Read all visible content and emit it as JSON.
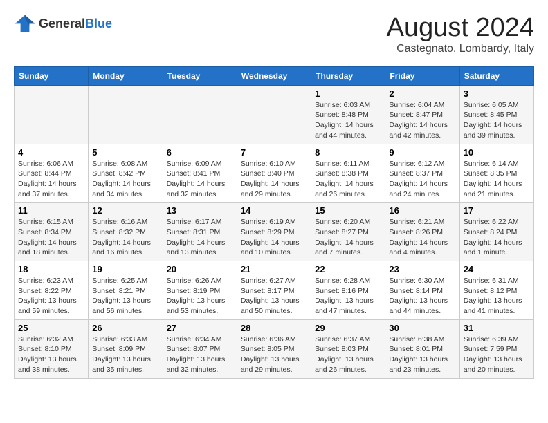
{
  "logo": {
    "text_general": "General",
    "text_blue": "Blue"
  },
  "header": {
    "month_year": "August 2024",
    "location": "Castegnato, Lombardy, Italy"
  },
  "days_of_week": [
    "Sunday",
    "Monday",
    "Tuesday",
    "Wednesday",
    "Thursday",
    "Friday",
    "Saturday"
  ],
  "weeks": [
    [
      {
        "day": "",
        "info": ""
      },
      {
        "day": "",
        "info": ""
      },
      {
        "day": "",
        "info": ""
      },
      {
        "day": "",
        "info": ""
      },
      {
        "day": "1",
        "info": "Sunrise: 6:03 AM\nSunset: 8:48 PM\nDaylight: 14 hours and 44 minutes."
      },
      {
        "day": "2",
        "info": "Sunrise: 6:04 AM\nSunset: 8:47 PM\nDaylight: 14 hours and 42 minutes."
      },
      {
        "day": "3",
        "info": "Sunrise: 6:05 AM\nSunset: 8:45 PM\nDaylight: 14 hours and 39 minutes."
      }
    ],
    [
      {
        "day": "4",
        "info": "Sunrise: 6:06 AM\nSunset: 8:44 PM\nDaylight: 14 hours and 37 minutes."
      },
      {
        "day": "5",
        "info": "Sunrise: 6:08 AM\nSunset: 8:42 PM\nDaylight: 14 hours and 34 minutes."
      },
      {
        "day": "6",
        "info": "Sunrise: 6:09 AM\nSunset: 8:41 PM\nDaylight: 14 hours and 32 minutes."
      },
      {
        "day": "7",
        "info": "Sunrise: 6:10 AM\nSunset: 8:40 PM\nDaylight: 14 hours and 29 minutes."
      },
      {
        "day": "8",
        "info": "Sunrise: 6:11 AM\nSunset: 8:38 PM\nDaylight: 14 hours and 26 minutes."
      },
      {
        "day": "9",
        "info": "Sunrise: 6:12 AM\nSunset: 8:37 PM\nDaylight: 14 hours and 24 minutes."
      },
      {
        "day": "10",
        "info": "Sunrise: 6:14 AM\nSunset: 8:35 PM\nDaylight: 14 hours and 21 minutes."
      }
    ],
    [
      {
        "day": "11",
        "info": "Sunrise: 6:15 AM\nSunset: 8:34 PM\nDaylight: 14 hours and 18 minutes."
      },
      {
        "day": "12",
        "info": "Sunrise: 6:16 AM\nSunset: 8:32 PM\nDaylight: 14 hours and 16 minutes."
      },
      {
        "day": "13",
        "info": "Sunrise: 6:17 AM\nSunset: 8:31 PM\nDaylight: 14 hours and 13 minutes."
      },
      {
        "day": "14",
        "info": "Sunrise: 6:19 AM\nSunset: 8:29 PM\nDaylight: 14 hours and 10 minutes."
      },
      {
        "day": "15",
        "info": "Sunrise: 6:20 AM\nSunset: 8:27 PM\nDaylight: 14 hours and 7 minutes."
      },
      {
        "day": "16",
        "info": "Sunrise: 6:21 AM\nSunset: 8:26 PM\nDaylight: 14 hours and 4 minutes."
      },
      {
        "day": "17",
        "info": "Sunrise: 6:22 AM\nSunset: 8:24 PM\nDaylight: 14 hours and 1 minute."
      }
    ],
    [
      {
        "day": "18",
        "info": "Sunrise: 6:23 AM\nSunset: 8:22 PM\nDaylight: 13 hours and 59 minutes."
      },
      {
        "day": "19",
        "info": "Sunrise: 6:25 AM\nSunset: 8:21 PM\nDaylight: 13 hours and 56 minutes."
      },
      {
        "day": "20",
        "info": "Sunrise: 6:26 AM\nSunset: 8:19 PM\nDaylight: 13 hours and 53 minutes."
      },
      {
        "day": "21",
        "info": "Sunrise: 6:27 AM\nSunset: 8:17 PM\nDaylight: 13 hours and 50 minutes."
      },
      {
        "day": "22",
        "info": "Sunrise: 6:28 AM\nSunset: 8:16 PM\nDaylight: 13 hours and 47 minutes."
      },
      {
        "day": "23",
        "info": "Sunrise: 6:30 AM\nSunset: 8:14 PM\nDaylight: 13 hours and 44 minutes."
      },
      {
        "day": "24",
        "info": "Sunrise: 6:31 AM\nSunset: 8:12 PM\nDaylight: 13 hours and 41 minutes."
      }
    ],
    [
      {
        "day": "25",
        "info": "Sunrise: 6:32 AM\nSunset: 8:10 PM\nDaylight: 13 hours and 38 minutes."
      },
      {
        "day": "26",
        "info": "Sunrise: 6:33 AM\nSunset: 8:09 PM\nDaylight: 13 hours and 35 minutes."
      },
      {
        "day": "27",
        "info": "Sunrise: 6:34 AM\nSunset: 8:07 PM\nDaylight: 13 hours and 32 minutes."
      },
      {
        "day": "28",
        "info": "Sunrise: 6:36 AM\nSunset: 8:05 PM\nDaylight: 13 hours and 29 minutes."
      },
      {
        "day": "29",
        "info": "Sunrise: 6:37 AM\nSunset: 8:03 PM\nDaylight: 13 hours and 26 minutes."
      },
      {
        "day": "30",
        "info": "Sunrise: 6:38 AM\nSunset: 8:01 PM\nDaylight: 13 hours and 23 minutes."
      },
      {
        "day": "31",
        "info": "Sunrise: 6:39 AM\nSunset: 7:59 PM\nDaylight: 13 hours and 20 minutes."
      }
    ]
  ]
}
